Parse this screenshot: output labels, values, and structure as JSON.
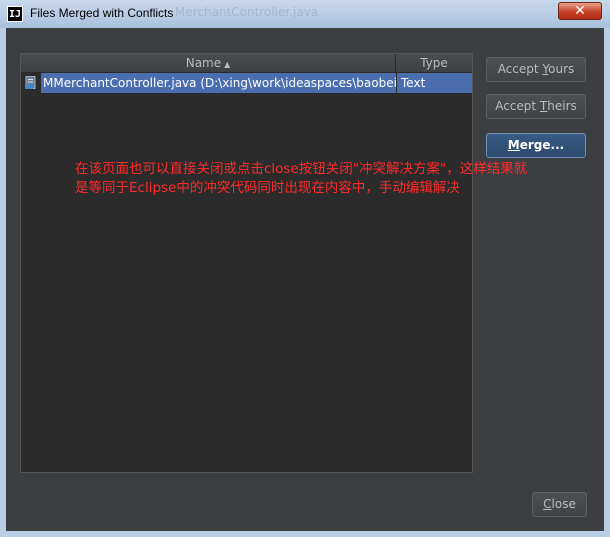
{
  "window": {
    "title": "Files Merged with Conflicts",
    "background_title": "MerchantController.java",
    "close_glyph": "✕"
  },
  "table": {
    "columns": [
      {
        "label": "Name",
        "sort": "ascending"
      },
      {
        "label": "Type"
      }
    ],
    "rows": [
      {
        "name": "MMerchantController.java (D:\\xing\\work\\ideaspaces\\baobeiw",
        "type": "Text",
        "icon": "java-file-icon",
        "selected": true
      }
    ]
  },
  "buttons": {
    "accept_yours": {
      "pre": "Accept ",
      "mnemonic": "Y",
      "post": "ours"
    },
    "accept_theirs": {
      "pre": "Accept ",
      "mnemonic": "T",
      "post": "heirs"
    },
    "merge": {
      "pre": "",
      "mnemonic": "M",
      "post": "erge..."
    },
    "close": {
      "pre": "",
      "mnemonic": "C",
      "post": "lose"
    }
  },
  "annotation": {
    "line1": "在该页面也可以直接关闭或点击close按钮关闭\"冲突解决方案\"，这样结果就",
    "line2": "是等同于Eclipse中的冲突代码同时出现在内容中，手动编辑解决"
  },
  "colors": {
    "annotation": "#ff2a2a",
    "selection": "#4b6eaf",
    "dialog_bg": "#3c3f41",
    "table_bg": "#2b2b2b"
  }
}
